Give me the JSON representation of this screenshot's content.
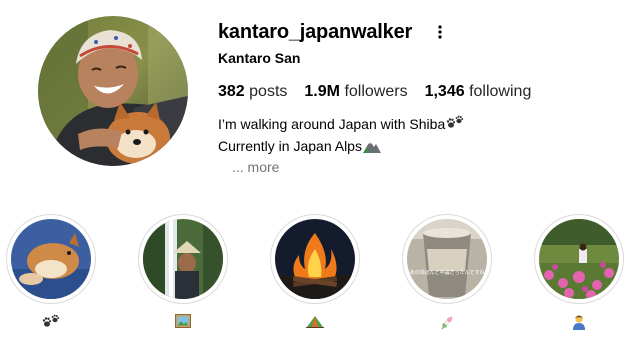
{
  "profile": {
    "username": "kantaro_japanwalker",
    "full_name": "Kantaro San",
    "avatar_icon": "profile-photo-man-with-shiba",
    "more_icon": "more-options-icon"
  },
  "stats": {
    "posts_count": "382",
    "posts_label": "posts",
    "followers_count": "1.9M",
    "followers_label": "followers",
    "following_count": "1,346",
    "following_label": "following"
  },
  "bio": {
    "line1": "I’m walking around Japan with Shiba",
    "line1_icon": "paw-prints-emoji",
    "line2": "Currently in Japan Alps",
    "line2_icon": "mountain-emoji",
    "more_label": "... more"
  },
  "highlights": [
    {
      "title_icon": "paw-prints-emoji",
      "cover_icon": "shiba-dog-photo"
    },
    {
      "title_icon": "framed-picture-emoji",
      "cover_icon": "waterfall-portrait-photo"
    },
    {
      "title_icon": "camping-tent-emoji",
      "cover_icon": "campfire-photo"
    },
    {
      "title_icon": "dango-emoji",
      "cover_icon": "drink-cup-photo",
      "cover_caption": "あの頃ほんと卒論だったんですね"
    },
    {
      "title_icon": "person-emoji",
      "cover_icon": "flower-garden-photo"
    }
  ],
  "colors": {
    "text": "#262626",
    "muted": "#737373",
    "ring": "#dbdbdb"
  }
}
